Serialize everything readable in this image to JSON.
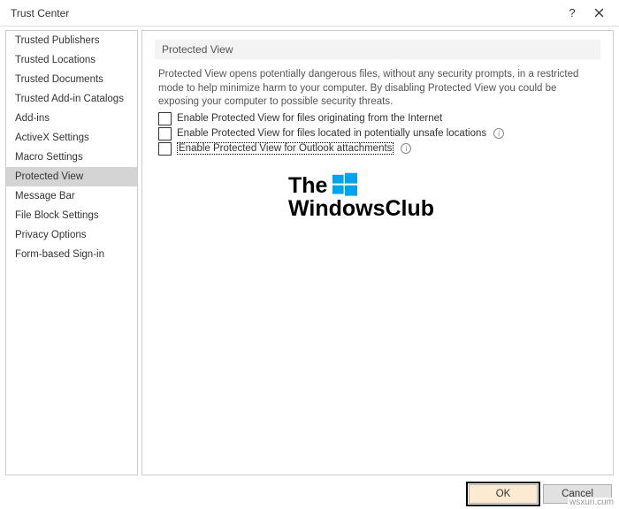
{
  "window": {
    "title": "Trust Center"
  },
  "sidebar": {
    "items": [
      {
        "label": "Trusted Publishers"
      },
      {
        "label": "Trusted Locations"
      },
      {
        "label": "Trusted Documents"
      },
      {
        "label": "Trusted Add-in Catalogs"
      },
      {
        "label": "Add-ins"
      },
      {
        "label": "ActiveX Settings"
      },
      {
        "label": "Macro Settings"
      },
      {
        "label": "Protected View"
      },
      {
        "label": "Message Bar"
      },
      {
        "label": "File Block Settings"
      },
      {
        "label": "Privacy Options"
      },
      {
        "label": "Form-based Sign-in"
      }
    ],
    "selected_index": 7
  },
  "main": {
    "header": "Protected View",
    "description": "Protected View opens potentially dangerous files, without any security prompts, in a restricted mode to help minimize harm to your computer. By disabling Protected View you could be exposing your computer to possible security threats.",
    "options": [
      {
        "label": "Enable Protected View for files originating from the Internet",
        "checked": false,
        "info": false
      },
      {
        "label": "Enable Protected View for files located in potentially unsafe locations",
        "checked": false,
        "info": true
      },
      {
        "label": "Enable Protected View for Outlook attachments",
        "checked": false,
        "info": true,
        "focused": true
      }
    ]
  },
  "watermark": {
    "line1": "The",
    "line2": "WindowsClub"
  },
  "buttons": {
    "ok": "OK",
    "cancel": "Cancel"
  },
  "corner": "wsxuri.cum"
}
